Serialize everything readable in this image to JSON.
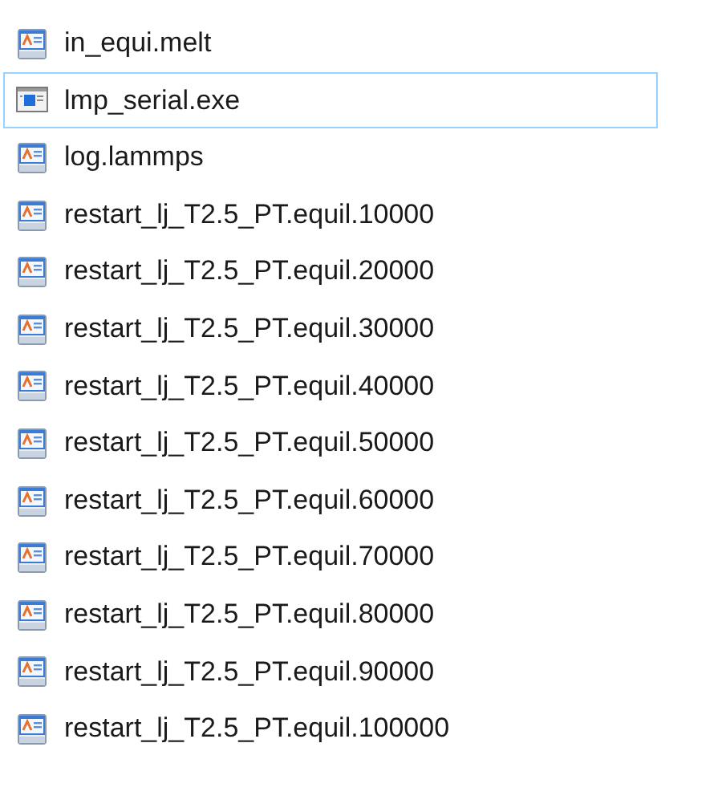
{
  "files": [
    {
      "name": "in_equi.melt",
      "kind": "document",
      "focused": false
    },
    {
      "name": "lmp_serial.exe",
      "kind": "program",
      "focused": true
    },
    {
      "name": "log.lammps",
      "kind": "document",
      "focused": false
    },
    {
      "name": "restart_lj_T2.5_PT.equil.10000",
      "kind": "document",
      "focused": false
    },
    {
      "name": "restart_lj_T2.5_PT.equil.20000",
      "kind": "document",
      "focused": false
    },
    {
      "name": "restart_lj_T2.5_PT.equil.30000",
      "kind": "document",
      "focused": false
    },
    {
      "name": "restart_lj_T2.5_PT.equil.40000",
      "kind": "document",
      "focused": false
    },
    {
      "name": "restart_lj_T2.5_PT.equil.50000",
      "kind": "document",
      "focused": false
    },
    {
      "name": "restart_lj_T2.5_PT.equil.60000",
      "kind": "document",
      "focused": false
    },
    {
      "name": "restart_lj_T2.5_PT.equil.70000",
      "kind": "document",
      "focused": false
    },
    {
      "name": "restart_lj_T2.5_PT.equil.80000",
      "kind": "document",
      "focused": false
    },
    {
      "name": "restart_lj_T2.5_PT.equil.90000",
      "kind": "document",
      "focused": false
    },
    {
      "name": "restart_lj_T2.5_PT.equil.100000",
      "kind": "document",
      "focused": false
    }
  ]
}
